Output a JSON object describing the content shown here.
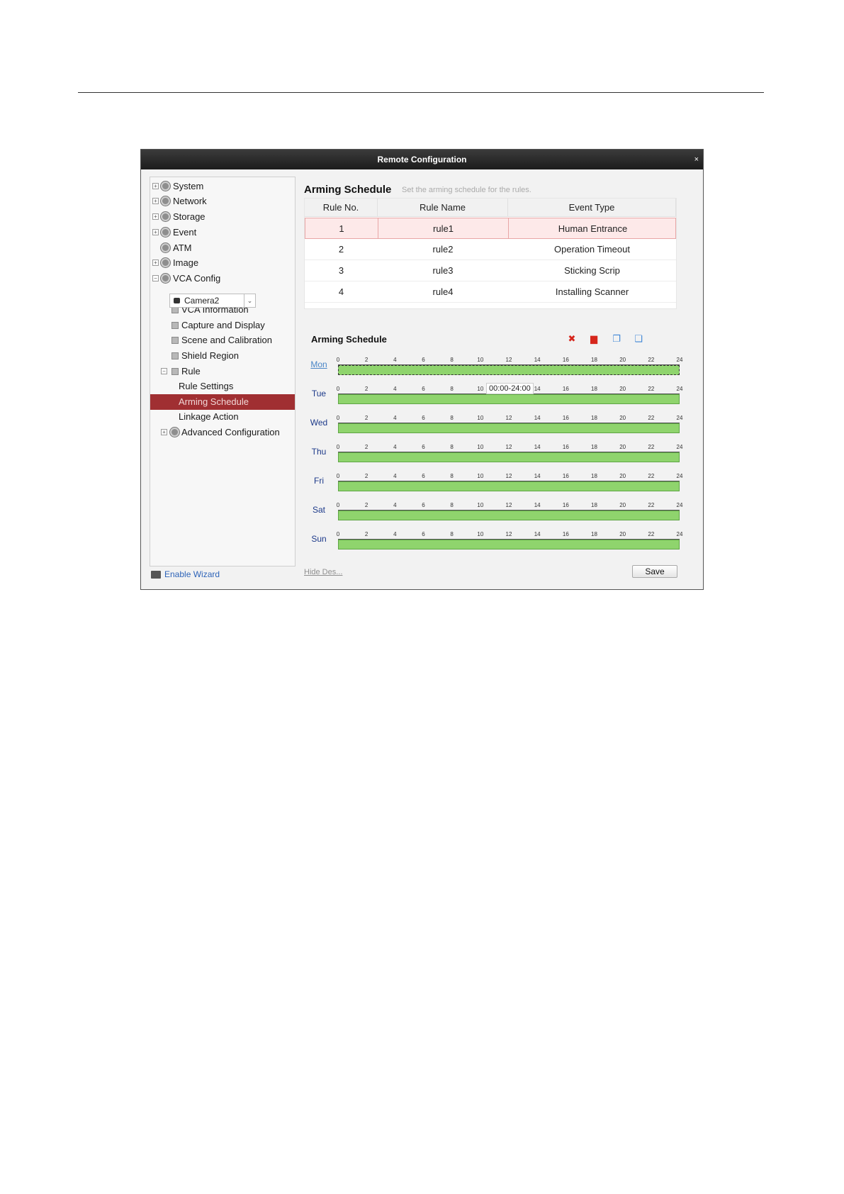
{
  "window": {
    "title": "Remote Configuration",
    "close_glyph": "×"
  },
  "sidebar": {
    "items": [
      {
        "label": "System",
        "icon": "gear-icon",
        "expander": "+"
      },
      {
        "label": "Network",
        "icon": "gear-icon",
        "expander": "+"
      },
      {
        "label": "Storage",
        "icon": "gear-icon",
        "expander": "+"
      },
      {
        "label": "Event",
        "icon": "gear-icon",
        "expander": "+"
      },
      {
        "label": "ATM",
        "icon": "gear-icon"
      },
      {
        "label": "Image",
        "icon": "gear-icon",
        "expander": "+"
      },
      {
        "label": "VCA Config",
        "icon": "gear-icon",
        "expander": "−"
      },
      {
        "label": "VCA Information",
        "icon": "info-icon"
      },
      {
        "label": "Capture and Display",
        "icon": "camera-icon"
      },
      {
        "label": "Scene and Calibration",
        "icon": "scene-icon"
      },
      {
        "label": "Shield Region",
        "icon": "shield-icon"
      },
      {
        "label": "Rule",
        "icon": "rule-icon",
        "expander": "−"
      },
      {
        "label": "Rule Settings"
      },
      {
        "label": "Arming Schedule",
        "selected": true
      },
      {
        "label": "Linkage Action"
      },
      {
        "label": "Advanced Configuration",
        "icon": "gear-icon",
        "expander": "+"
      }
    ],
    "camera_select": {
      "value": "Camera2"
    },
    "wizard_label": "Enable Wizard"
  },
  "main": {
    "title": "Arming Schedule",
    "description": "Set the arming schedule for the rules.",
    "table": {
      "headers": [
        "Rule No.",
        "Rule Name",
        "Event Type"
      ],
      "rows": [
        {
          "no": "1",
          "name": "rule1",
          "event": "Human Entrance",
          "selected": true
        },
        {
          "no": "2",
          "name": "rule2",
          "event": "Operation Timeout"
        },
        {
          "no": "3",
          "name": "rule3",
          "event": "Sticking Scrip"
        },
        {
          "no": "4",
          "name": "rule4",
          "event": "Installing Scanner"
        }
      ]
    },
    "schedule": {
      "title": "Arming Schedule",
      "tools": [
        "delete-icon",
        "trash-icon",
        "copy-icon",
        "copy-all-icon"
      ],
      "tick_labels": [
        "0",
        "2",
        "4",
        "6",
        "8",
        "10",
        "12",
        "14",
        "16",
        "18",
        "20",
        "22",
        "24"
      ],
      "days": [
        {
          "label": "Mon",
          "active": true
        },
        {
          "label": "Tue",
          "tooltip": "00:00-24:00"
        },
        {
          "label": "Wed"
        },
        {
          "label": "Thu"
        },
        {
          "label": "Fri"
        },
        {
          "label": "Sat"
        },
        {
          "label": "Sun"
        }
      ],
      "armed_hours": [
        0,
        24
      ],
      "bar_color": "#8fd46d"
    },
    "hide_desc_label": "Hide Des...",
    "save_label": "Save"
  },
  "colors": {
    "selected_nav": "#a02f32",
    "titlebar": "#2a2a2a",
    "selected_row": "#fde9e9"
  }
}
